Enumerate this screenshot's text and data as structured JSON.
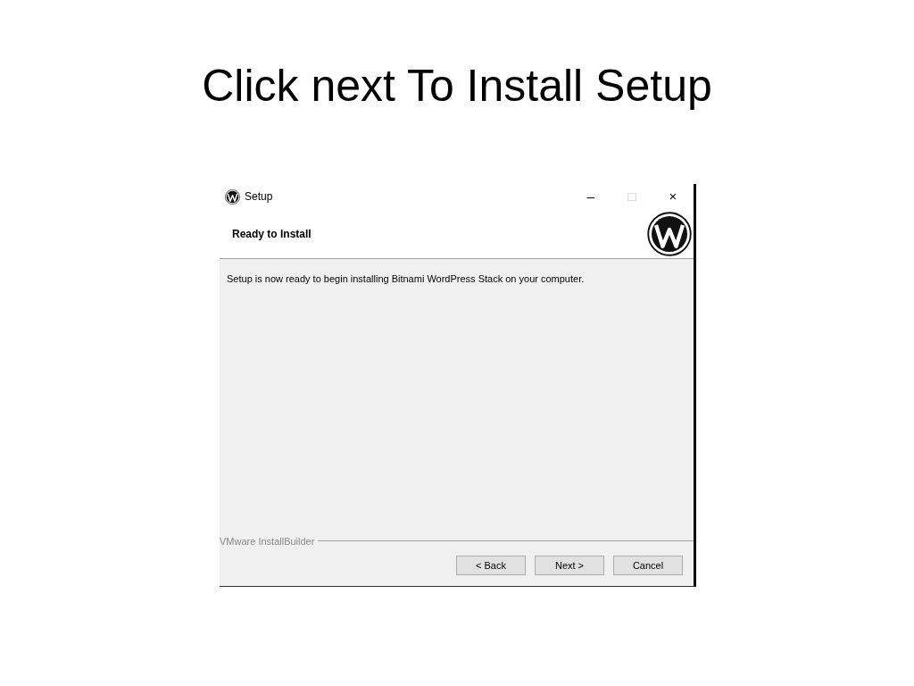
{
  "slide_title": "Click next To Install Setup",
  "window": {
    "title": "Setup",
    "controls": [
      "–",
      "□",
      "×"
    ]
  },
  "header": {
    "title": "Ready to Install"
  },
  "body": {
    "message": "Setup is now ready to begin installing Bitnami WordPress Stack on your computer."
  },
  "footer": {
    "brand": "VMware InstallBuilder",
    "buttons": [
      "< Back",
      "Next >",
      "Cancel"
    ]
  }
}
